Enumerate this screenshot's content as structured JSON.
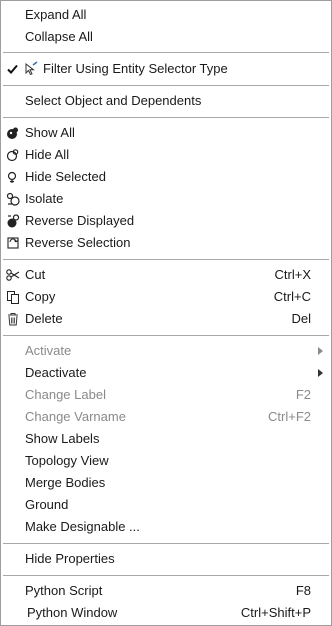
{
  "menu": {
    "expand_all": "Expand All",
    "collapse_all": "Collapse All",
    "filter_entity": "Filter Using Entity Selector Type",
    "select_object_dependents": "Select Object and Dependents",
    "show_all": "Show All",
    "hide_all": "Hide All",
    "hide_selected": "Hide Selected",
    "isolate": "Isolate",
    "reverse_displayed": "Reverse Displayed",
    "reverse_selection": "Reverse Selection",
    "cut": {
      "label": "Cut",
      "shortcut": "Ctrl+X"
    },
    "copy": {
      "label": "Copy",
      "shortcut": "Ctrl+C"
    },
    "delete": {
      "label": "Delete",
      "shortcut": "Del"
    },
    "activate": "Activate",
    "deactivate": "Deactivate",
    "change_label": {
      "label": "Change Label",
      "shortcut": "F2"
    },
    "change_varname": {
      "label": "Change Varname",
      "shortcut": "Ctrl+F2"
    },
    "show_labels": "Show Labels",
    "topology_view": "Topology View",
    "merge_bodies": "Merge Bodies",
    "ground": "Ground",
    "make_designable": "Make Designable ...",
    "hide_properties": "Hide Properties",
    "python_script": {
      "label": "Python Script",
      "shortcut": "F8"
    },
    "python_window": {
      "label": "Python Window",
      "shortcut": "Ctrl+Shift+P"
    }
  },
  "colors": {
    "disabled_text": "#8a8a8a",
    "separator": "#a8a8a8",
    "border": "#9e9e9e"
  }
}
